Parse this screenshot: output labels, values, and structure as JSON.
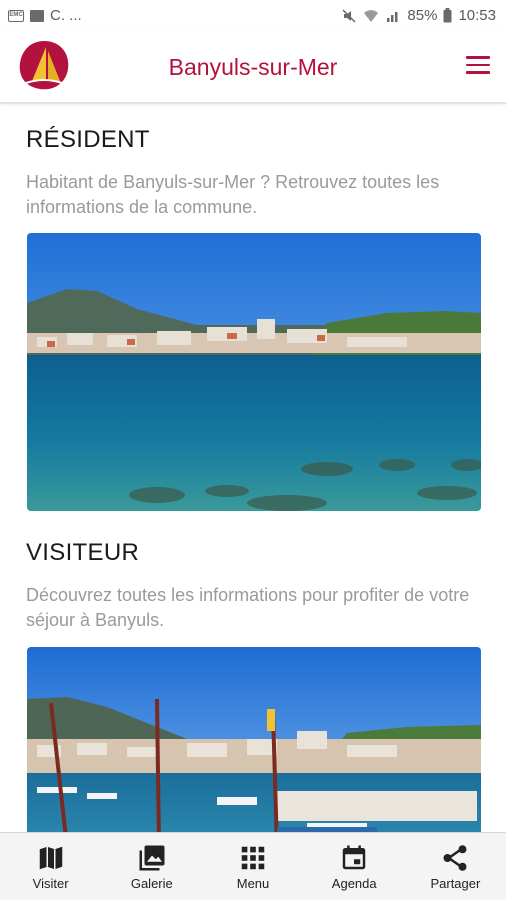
{
  "status_bar": {
    "left_text": "C. ...",
    "battery": "85%",
    "time": "10:53"
  },
  "header": {
    "title": "Banyuls-sur-Mer"
  },
  "sections": [
    {
      "title": "RÉSIDENT",
      "description": "Habitant de Banyuls-sur-Mer ? Retrouvez toutes les informations de la commune."
    },
    {
      "title": "VISITEUR",
      "description": "Découvrez toutes les informations pour profiter de votre séjour à Banyuls."
    }
  ],
  "bottom_nav": [
    {
      "label": "Visiter",
      "icon": "map-icon"
    },
    {
      "label": "Galerie",
      "icon": "gallery-icon"
    },
    {
      "label": "Menu",
      "icon": "grid-icon"
    },
    {
      "label": "Agenda",
      "icon": "calendar-icon"
    },
    {
      "label": "Partager",
      "icon": "share-icon"
    }
  ],
  "colors": {
    "brand": "#b3123e",
    "sky": "#2a7fd8",
    "sea": "#0f6a92"
  }
}
